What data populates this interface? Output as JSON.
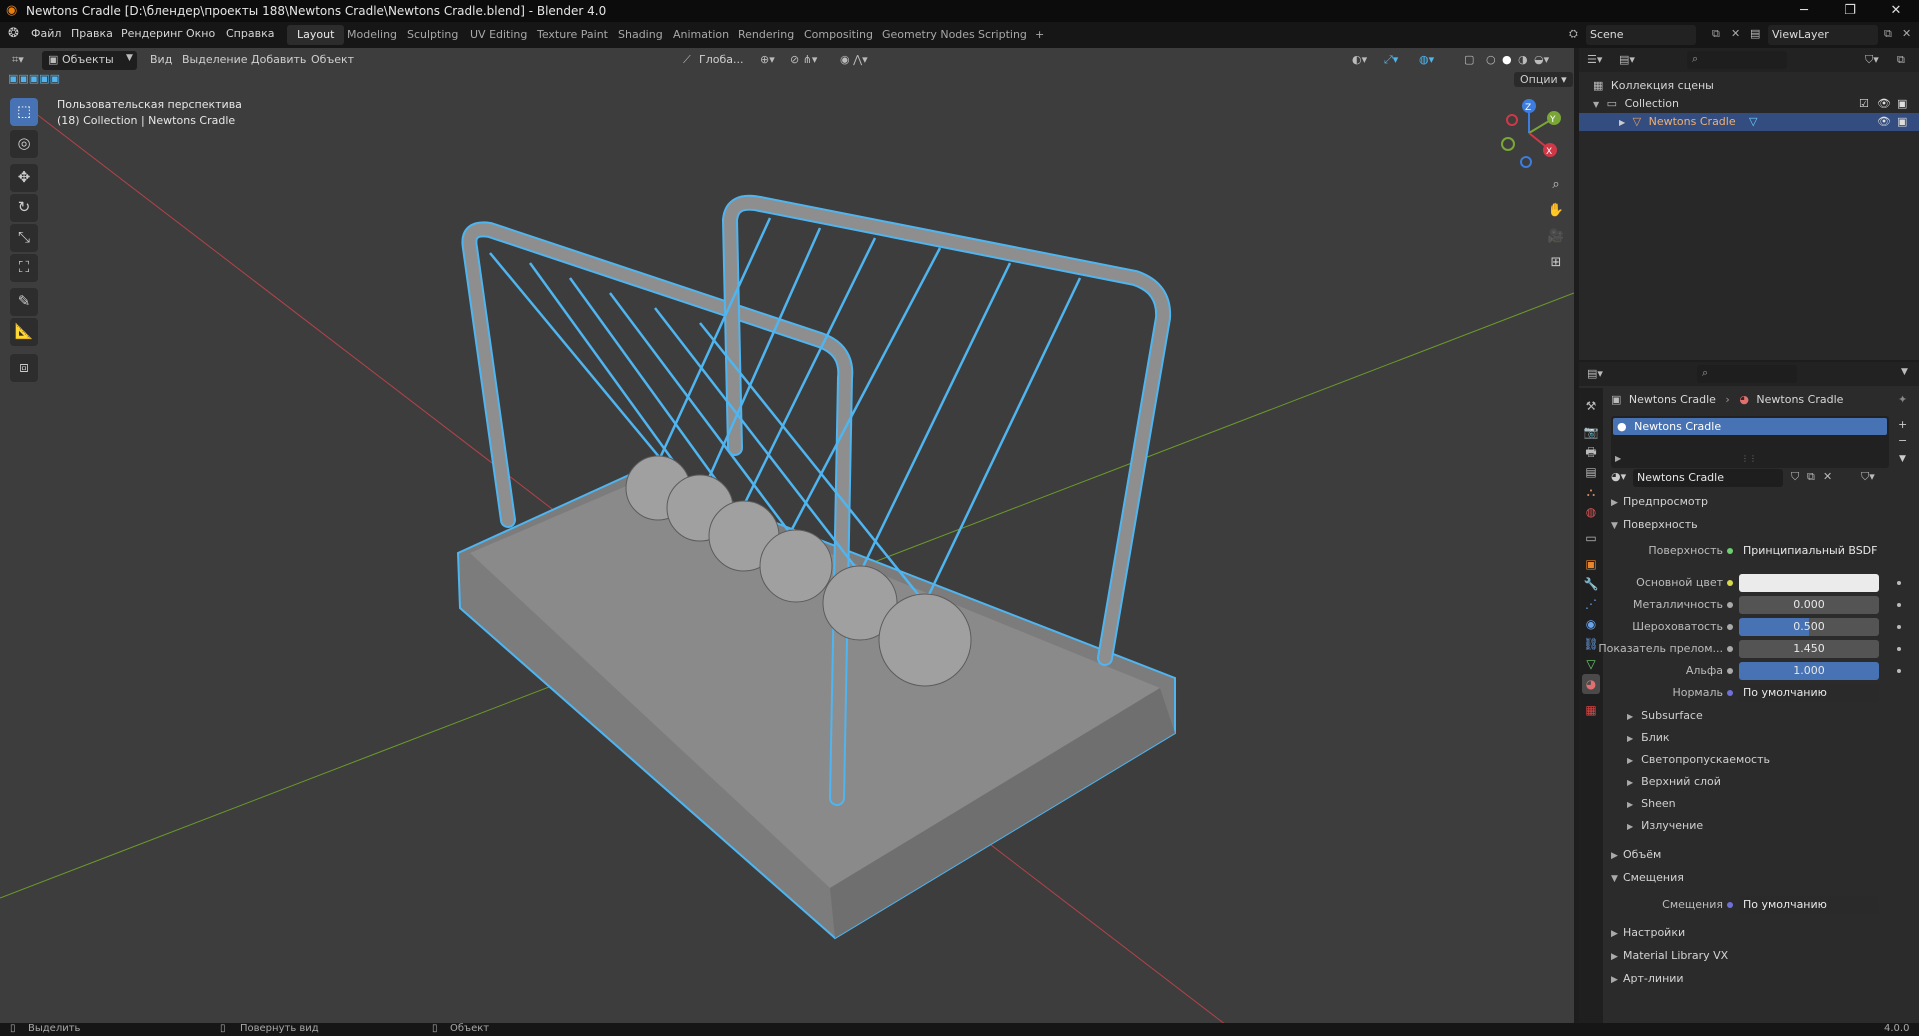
{
  "window": {
    "title": "Newtons Cradle [D:\\блендер\\проекты 188\\Newtons Cradle\\Newtons Cradle.blend] - Blender 4.0",
    "controls": [
      "─",
      "❐",
      "✕"
    ]
  },
  "menu": {
    "items": [
      "Файл",
      "Правка",
      "Рендеринг",
      "Окно",
      "Справка"
    ],
    "workspaces": [
      "Layout",
      "Modeling",
      "Sculpting",
      "UV Editing",
      "Texture Paint",
      "Shading",
      "Animation",
      "Rendering",
      "Compositing",
      "Geometry Nodes",
      "Scripting"
    ],
    "active_workspace": "Layout",
    "add_tab": "+",
    "scene": "Scene",
    "view_layer": "ViewLayer"
  },
  "viewport": {
    "mode": "Объекты",
    "menus": [
      "Вид",
      "Выделение",
      "Добавить",
      "Объект"
    ],
    "transform_orientation": "Глоба...",
    "options": "Опции",
    "overlay_line1": "Пользовательская перспектива",
    "overlay_line2": "(18) Collection | Newtons Cradle",
    "gizmo": {
      "x": "X",
      "y": "Y",
      "z": "Z"
    },
    "colors": {
      "background": "#3d3d3d",
      "selection": "#4fb5f0",
      "x_axis": "#b2434b",
      "y_axis": "#6b9a2d"
    }
  },
  "outliner": {
    "rows": [
      {
        "label": "Коллекция сцены",
        "indent": 0
      },
      {
        "label": "Collection",
        "indent": 1
      },
      {
        "label": "Newtons Cradle",
        "indent": 2
      }
    ]
  },
  "properties": {
    "breadcrumb": {
      "object": "Newtons Cradle",
      "material": "Newtons Cradle"
    },
    "slot": "Newtons Cradle",
    "material_name": "Newtons Cradle",
    "sections": {
      "preview": "Предпросмотр",
      "surface": "Поверхность",
      "volume": "Объём",
      "displacement": "Смещения",
      "settings": "Настройки",
      "library": "Material Library VX",
      "lineart": "Арт-линии"
    },
    "surface_rows": {
      "surface_label": "Поверхность",
      "surface_value": "Принципиальный BSDF",
      "base_color_label": "Основной цвет",
      "metallic_label": "Металличность",
      "metallic_value": "0.000",
      "roughness_label": "Шероховатость",
      "roughness_value": "0.500",
      "ior_label": "Показатель прелом...",
      "ior_value": "1.450",
      "alpha_label": "Альфа",
      "alpha_value": "1.000",
      "normal_label": "Нормаль",
      "normal_value": "По умолчанию"
    },
    "subsections": [
      "Subsurface",
      "Блик",
      "Светопропускаемость",
      "Верхний слой",
      "Sheen",
      "Излучение"
    ],
    "displacement_label": "Смещения",
    "displacement_value": "По умолчанию",
    "base_color": "#ebebeb"
  },
  "status": {
    "select": "Выделить",
    "rotate": "Повернуть вид",
    "object": "Объект",
    "version": "4.0.0"
  }
}
